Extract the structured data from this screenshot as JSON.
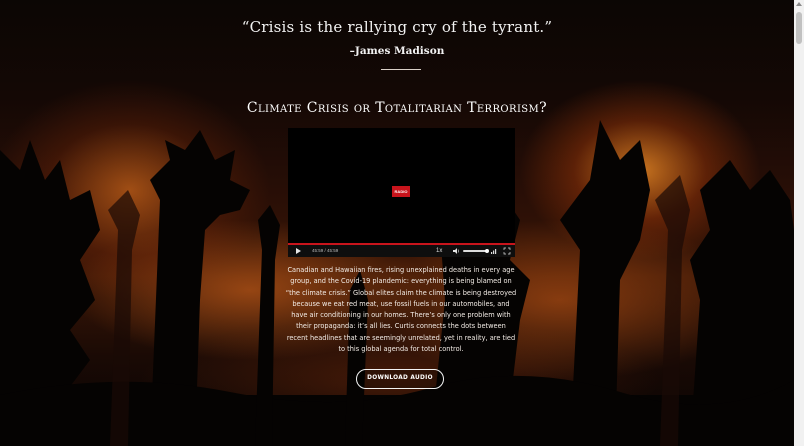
{
  "quote": {
    "text": "“Crisis is the rallying cry of the tyrant.”",
    "author": "–James Madison"
  },
  "section": {
    "title": "Climate Crisis or Totalitarian Terrorism?"
  },
  "video": {
    "logo_text": "RADIO",
    "time": "45:59 / 45:59",
    "speed": "1x",
    "icons": [
      "play-icon",
      "volume-icon",
      "quality-icon",
      "fullscreen-icon"
    ],
    "progress": 1.0,
    "volume": 0.9
  },
  "description": {
    "text": "Canadian and Hawaiian fires, rising unexplained deaths in every age group, and the Covid-19 plandemic: everything is being blamed on “the climate crisis.” Global elites claim the climate is being destroyed because we eat red meat, use fossil fuels in our automobiles, and have air conditioning in our homes. There’s only one problem with their propaganda: it’s all lies. Curtis connects the dots between recent headlines that are seemingly unrelated, yet in reality, are tied to this global agenda for total control."
  },
  "download": {
    "label": "DOWNLOAD AUDIO"
  },
  "colors": {
    "accent": "#c8141c",
    "text": "#f2f2f2",
    "background": "#0a0503"
  }
}
